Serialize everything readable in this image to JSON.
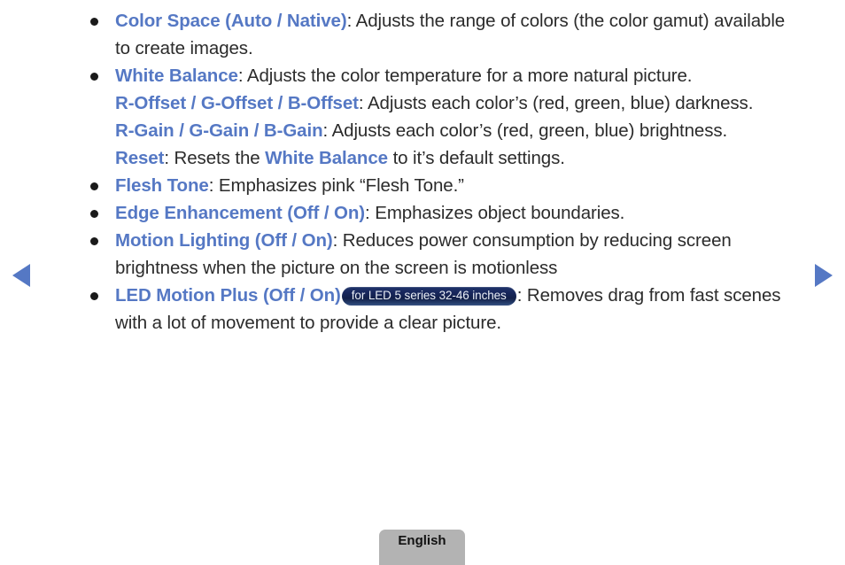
{
  "nav": {
    "prev_label": "previous page",
    "next_label": "next page"
  },
  "footer": {
    "language": "English"
  },
  "badge": {
    "led_motion_plus": "for LED 5 series 32-46 inches"
  },
  "content": {
    "items": [
      {
        "term": "Color Space (Auto / Native)",
        "sep": ": ",
        "desc": "Adjusts the range of colors (the color gamut) available to create images."
      },
      {
        "term": "White Balance",
        "sep": ": ",
        "desc": "Adjusts the color temperature for a more natural picture."
      },
      {
        "term": "Flesh Tone",
        "sep": ": ",
        "desc": "Emphasizes pink “Flesh Tone.”"
      },
      {
        "term": "Edge Enhancement (Off / On)",
        "sep": ": ",
        "desc": "Emphasizes object boundaries."
      },
      {
        "term": "Motion Lighting (Off / On)",
        "sep": ": ",
        "desc": "Reduces power consumption by reducing screen brightness when the picture on the screen is motionless"
      },
      {
        "term": "LED Motion Plus (Off / On)",
        "sep": ": ",
        "desc": "Removes drag from fast scenes with a lot of movement to provide a clear picture."
      }
    ],
    "sub_items": [
      {
        "term": "R-Offset / G-Offset / B-Offset",
        "sep": ": ",
        "desc": "Adjusts each color’s (red, green, blue) darkness."
      },
      {
        "term": "R-Gain / G-Gain / B-Gain",
        "sep": ": ",
        "desc": "Adjusts each color’s (red, green, blue) brightness."
      },
      {
        "term": "Reset",
        "sep": ": ",
        "desc_before": "Resets the ",
        "desc_link": "White Balance",
        "desc_after": " to it’s default settings."
      }
    ]
  },
  "colors": {
    "keyword_blue": "#5578c4",
    "body_text": "#2b2b2b",
    "badge_navy": "#16255a",
    "tab_gray": "#b3b3b3",
    "background": "#ffffff"
  }
}
